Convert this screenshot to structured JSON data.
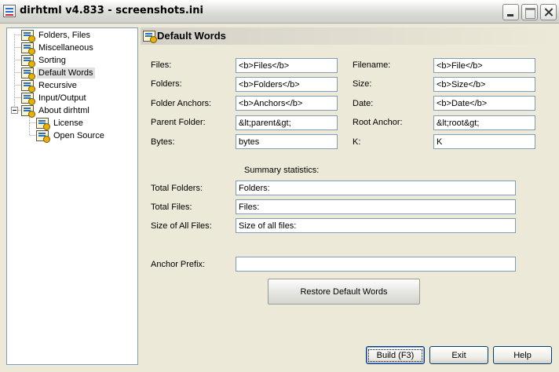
{
  "window": {
    "title": "dirhtml v4.833 - screenshots.ini"
  },
  "tree": {
    "items": [
      {
        "label": "Folders, Files"
      },
      {
        "label": "Miscellaneous"
      },
      {
        "label": "Sorting"
      },
      {
        "label": "Default Words"
      },
      {
        "label": "Recursive"
      },
      {
        "label": "Input/Output"
      },
      {
        "label": "About dirhtml"
      },
      {
        "label": "License"
      },
      {
        "label": "Open Source"
      }
    ]
  },
  "panel": {
    "title": "Default Words"
  },
  "fields": {
    "files": {
      "label": "Files:",
      "value": "<b>Files</b>"
    },
    "folders": {
      "label": "Folders:",
      "value": "<b>Folders</b>"
    },
    "folder_anchors": {
      "label": "Folder Anchors:",
      "value": "<b>Anchors</b>"
    },
    "parent_folder": {
      "label": "Parent Folder:",
      "value": "&lt;parent&gt;"
    },
    "bytes": {
      "label": "Bytes:",
      "value": "bytes"
    },
    "filename": {
      "label": "Filename:",
      "value": "<b>File</b>"
    },
    "size": {
      "label": "Size:",
      "value": "<b>Size</b>"
    },
    "date": {
      "label": "Date:",
      "value": "<b>Date</b>"
    },
    "root_anchor": {
      "label": "Root Anchor:",
      "value": "&lt;root&gt;"
    },
    "k": {
      "label": "K:",
      "value": "K"
    }
  },
  "summary": {
    "title": "Summary statistics:",
    "total_folders": {
      "label": "Total Folders:",
      "value": "Folders:"
    },
    "total_files": {
      "label": "Total Files:",
      "value": "Files:"
    },
    "size_all_files": {
      "label": "Size of All Files:",
      "value": "Size of all files:"
    }
  },
  "anchor_prefix": {
    "label": "Anchor Prefix:",
    "value": ""
  },
  "buttons": {
    "restore": "Restore Default Words",
    "build": "Build (F3)",
    "exit": "Exit",
    "help": "Help"
  }
}
